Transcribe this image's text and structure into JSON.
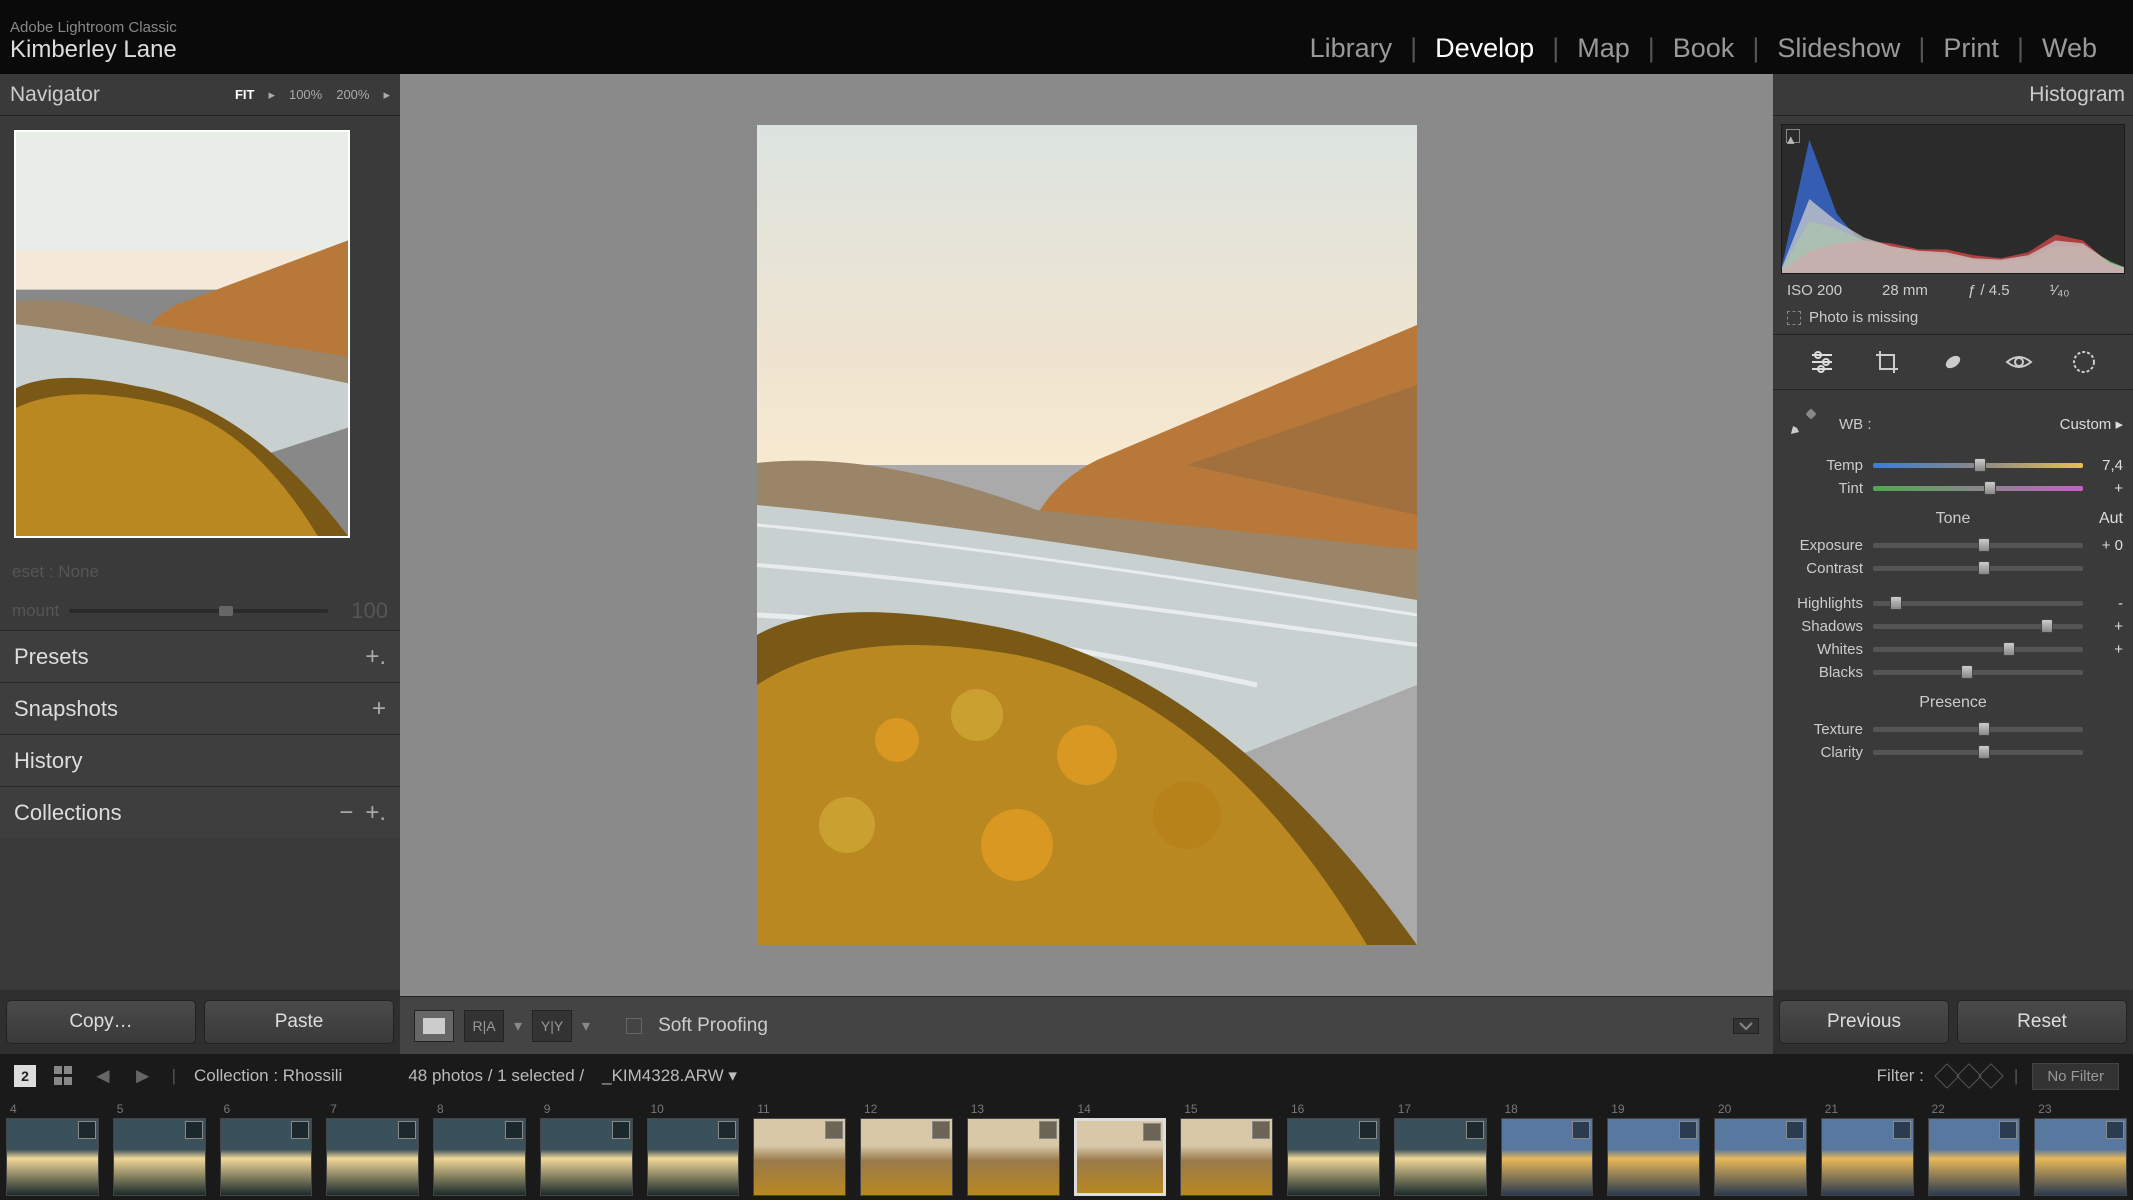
{
  "header": {
    "app": "Adobe Lightroom Classic",
    "user": "Kimberley Lane",
    "modules": [
      "Library",
      "Develop",
      "Map",
      "Book",
      "Slideshow",
      "Print",
      "Web"
    ],
    "active_module": "Develop"
  },
  "left": {
    "navigator": "Navigator",
    "zoom": {
      "fit": "FIT",
      "full": "100%",
      "z2": "200%"
    },
    "preset_line": "eset : None",
    "amount_label": "mount",
    "amount_value": "100",
    "sections": {
      "presets": "Presets",
      "snapshots": "Snapshots",
      "history": "History",
      "collections": "Collections"
    },
    "buttons": {
      "copy": "Copy…",
      "paste": "Paste"
    }
  },
  "center": {
    "soft_proofing": "Soft Proofing",
    "btn_ra": "R|A",
    "btn_yy": "Y|Y"
  },
  "right": {
    "title": "Histogram",
    "meta": {
      "iso": "ISO 200",
      "focal": "28 mm",
      "aperture": "ƒ / 4.5",
      "shutter_frac": "¹⁄₄₀"
    },
    "warn": "Photo is missing",
    "wb": {
      "label": "WB :",
      "value": "Custom"
    },
    "temp": {
      "label": "Temp",
      "value": "7,4"
    },
    "tint": {
      "label": "Tint",
      "value": "+"
    },
    "tone_title": "Tone",
    "auto": "Aut",
    "sliders": {
      "exposure": {
        "label": "Exposure",
        "value": "+ 0",
        "pos": 50
      },
      "contrast": {
        "label": "Contrast",
        "value": "",
        "pos": 50
      },
      "highlights": {
        "label": "Highlights",
        "value": "-",
        "pos": 8
      },
      "shadows": {
        "label": "Shadows",
        "value": "+",
        "pos": 80
      },
      "whites": {
        "label": "Whites",
        "value": "+",
        "pos": 62
      },
      "blacks": {
        "label": "Blacks",
        "value": "",
        "pos": 42
      },
      "texture": {
        "label": "Texture",
        "value": "",
        "pos": 50
      },
      "clarity": {
        "label": "Clarity",
        "value": "",
        "pos": 50
      }
    },
    "presence_title": "Presence",
    "buttons": {
      "previous": "Previous",
      "reset": "Reset"
    }
  },
  "infobar": {
    "badge": "2",
    "collection_label": "Collection : Rhossili",
    "count": "48 photos / 1 selected /",
    "filename": "_KIM4328.ARW",
    "filter_label": "Filter :",
    "no_filter": "No Filter"
  },
  "filmstrip": {
    "start": 4,
    "count": 20,
    "selected": 14
  },
  "chart_data": {
    "type": "area",
    "title": "Histogram",
    "x": [
      0,
      8,
      16,
      24,
      32,
      40,
      48,
      56,
      64,
      72,
      80,
      88,
      96,
      100
    ],
    "series": [
      {
        "name": "blue",
        "color": "#3a6fe0",
        "values": [
          5,
          90,
          40,
          18,
          12,
          10,
          8,
          6,
          6,
          5,
          8,
          10,
          5,
          3
        ]
      },
      {
        "name": "green",
        "color": "#4fb24f",
        "values": [
          3,
          35,
          30,
          22,
          18,
          14,
          12,
          8,
          8,
          10,
          18,
          18,
          8,
          4
        ]
      },
      {
        "name": "red",
        "color": "#d84a4a",
        "values": [
          2,
          15,
          20,
          22,
          20,
          16,
          16,
          12,
          10,
          14,
          26,
          22,
          6,
          3
        ]
      },
      {
        "name": "luma",
        "color": "#cccccc",
        "values": [
          4,
          50,
          35,
          24,
          18,
          15,
          14,
          10,
          9,
          12,
          22,
          20,
          7,
          4
        ]
      }
    ],
    "xlabel": "",
    "ylabel": "",
    "ylim": [
      0,
      100
    ]
  }
}
